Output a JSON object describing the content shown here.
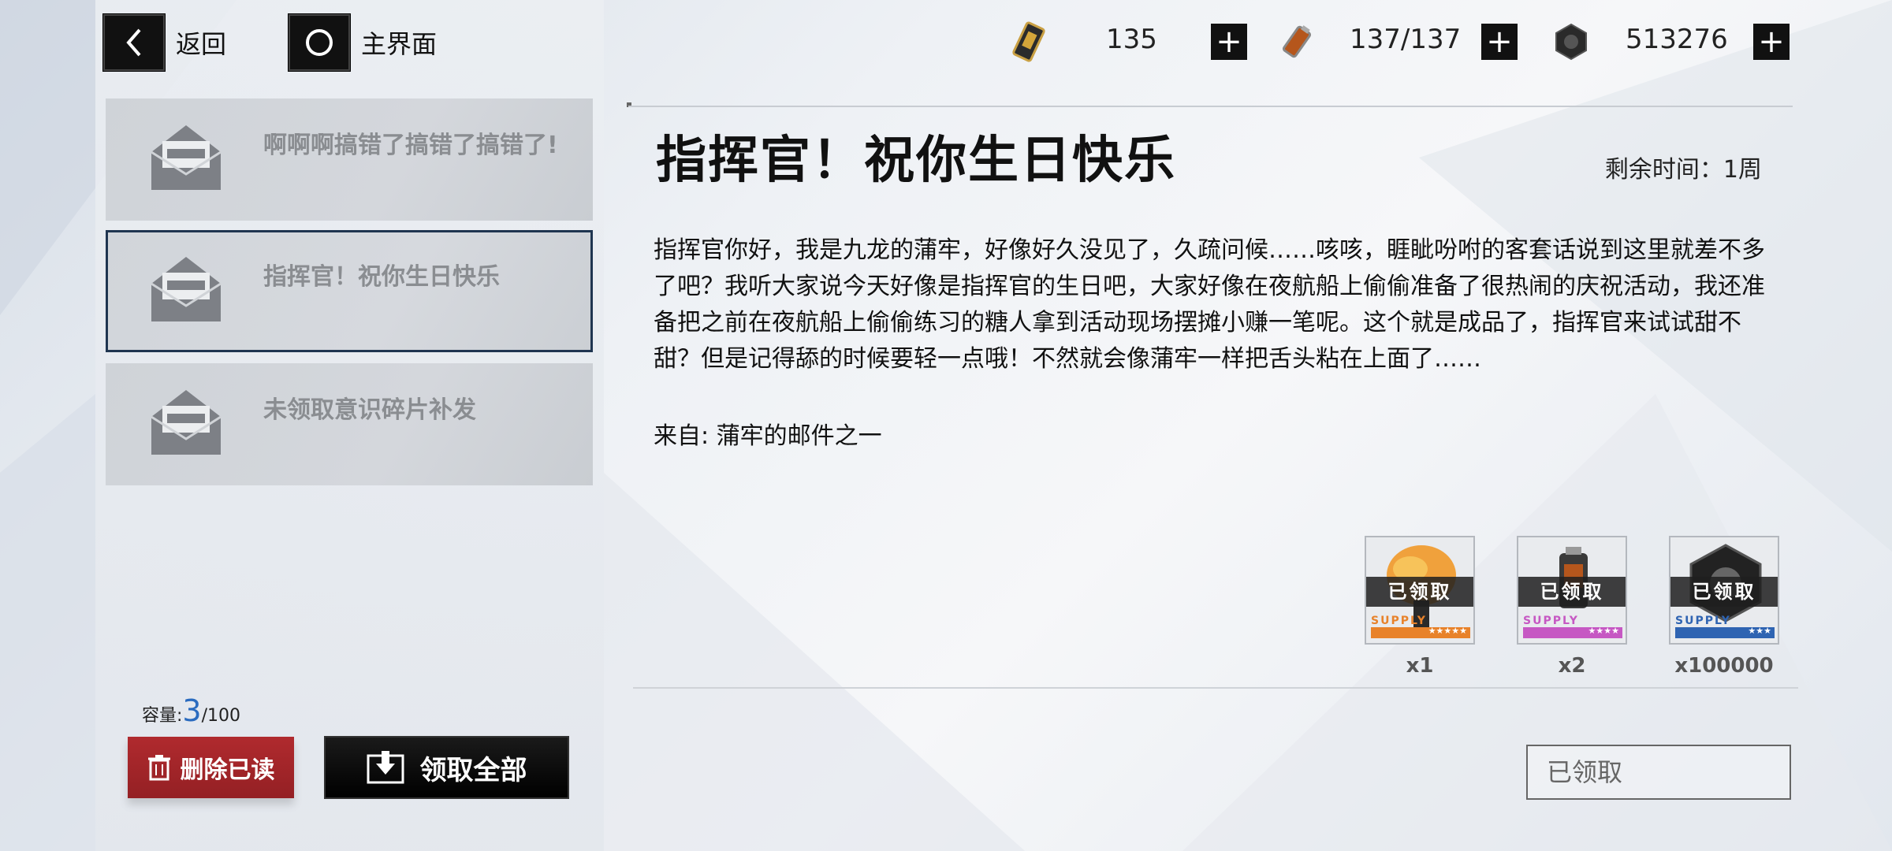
{
  "nav": {
    "back_label": "返回",
    "home_label": "主界面"
  },
  "resources": [
    {
      "icon": "stamina-card-icon",
      "value": "135"
    },
    {
      "icon": "battery-icon",
      "value": "137/137"
    },
    {
      "icon": "gear-nut-icon",
      "value": "513276"
    }
  ],
  "mail_list": [
    {
      "title": "啊啊啊搞错了搞错了搞错了!",
      "selected": false
    },
    {
      "title": "指挥官！祝你生日快乐",
      "selected": true
    },
    {
      "title": "未领取意识碎片补发",
      "selected": false
    }
  ],
  "capacity": {
    "label": "容量:",
    "current": "3",
    "max": "/100"
  },
  "buttons": {
    "delete_read": "删除已读",
    "claim_all": "领取全部",
    "claimed": "已领取"
  },
  "mail": {
    "heading": "指挥官！祝你生日快乐",
    "remaining": "剩余时间：1周",
    "body": "指挥官你好，我是九龙的蒲牢，好像好久没见了，久疏问候……咳咳，睚眦吩咐的客套话说到这里就差不多了吧？我听大家说今天好像是指挥官的生日吧，大家好像在夜航船上偷偷准备了很热闹的庆祝活动，我还准备把之前在夜航船上偷偷练习的糖人拿到活动现场摆摊小赚一笔呢。这个就是成品了，指挥官来试试甜不甜？但是记得舔的时候要轻一点哦！不然就会像蒲牢一样把舌头粘在上面了……",
    "from": "来自: 蒲牢的邮件之一"
  },
  "rewards": [
    {
      "claimed_label": "已领取",
      "supply": "SUPPLY",
      "stars": "★★★★★",
      "qty": "x1",
      "color": "#e8822a"
    },
    {
      "claimed_label": "已领取",
      "supply": "SUPPLY",
      "stars": "★★★★",
      "qty": "x2",
      "color": "#c658c3"
    },
    {
      "claimed_label": "已领取",
      "supply": "SUPPLY",
      "stars": "★★★",
      "qty": "x100000",
      "color": "#2f64b2"
    }
  ]
}
